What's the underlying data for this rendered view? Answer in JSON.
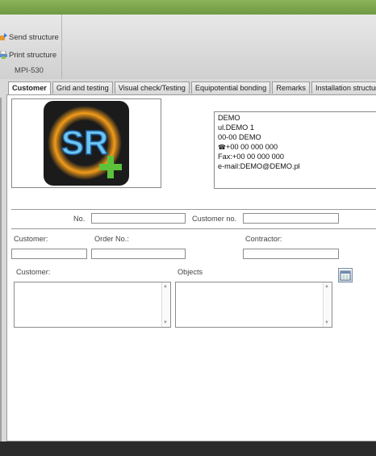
{
  "ribbon": {
    "send_label": "Send structure",
    "print_label": "Print structure",
    "group_label": "MPI-530"
  },
  "tabs": [
    {
      "label": "Customer",
      "active": true
    },
    {
      "label": "Grid and testing",
      "active": false
    },
    {
      "label": "Visual check/Testing",
      "active": false
    },
    {
      "label": "Equipotential bonding",
      "active": false
    },
    {
      "label": "Remarks",
      "active": false
    },
    {
      "label": "Installation structure",
      "active": false
    }
  ],
  "logo": {
    "text": "SR",
    "icon": "sr-logo-icon"
  },
  "address": {
    "name": "DEMO",
    "street": "ul.DEMO 1",
    "city": "00-00 DEMO",
    "phone": "+00 00 000 000",
    "fax": "Fax:+00 00 000 000",
    "email": "e-mail:DEMO@DEMO.pl"
  },
  "form": {
    "no_label": "No.",
    "no_value": "",
    "customer_no_label": "Customer no.",
    "customer_no_value": "",
    "customer_label": "Customer:",
    "customer_value": "",
    "order_no_label": "Order No.:",
    "order_no_value": "",
    "contractor_label": "Contractor:",
    "contractor_value": "",
    "customer_notes_label": "Customer:",
    "customer_notes_value": "",
    "objects_label": "Objects",
    "objects_value": ""
  },
  "colors": {
    "titlebar": "#7aa64d",
    "ribbon": "#dcdcdc",
    "panel": "#ffffff",
    "bottombar": "#2b2b2b"
  }
}
